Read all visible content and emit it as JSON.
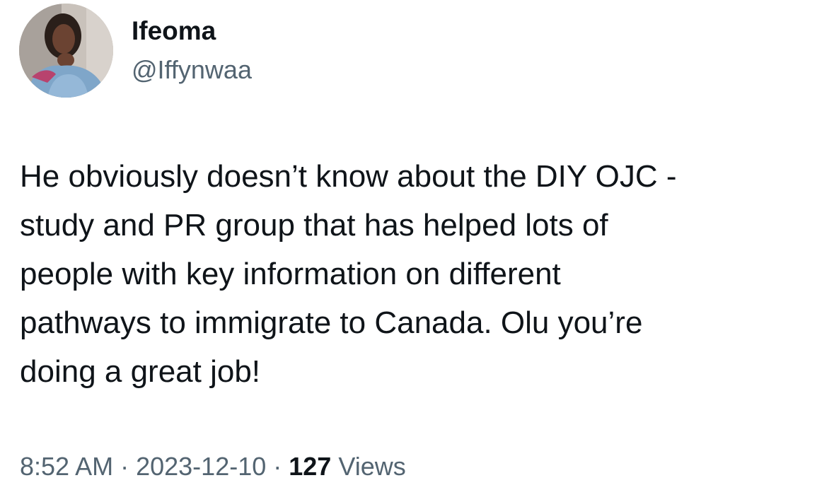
{
  "author": {
    "display_name": "Ifeoma",
    "handle": "@Iffynwaa"
  },
  "tweet": {
    "lines": [
      "He obviously doesn’t know about the DIY OJC -",
      "study and PR group that has helped lots of",
      "people with key information on different",
      "pathways to immigrate to Canada. Olu you’re",
      "doing a great job!"
    ]
  },
  "meta": {
    "time": "8:52 AM",
    "separator": " · ",
    "date": "2023-12-10",
    "views_count": "127",
    "views_label": " Views"
  }
}
